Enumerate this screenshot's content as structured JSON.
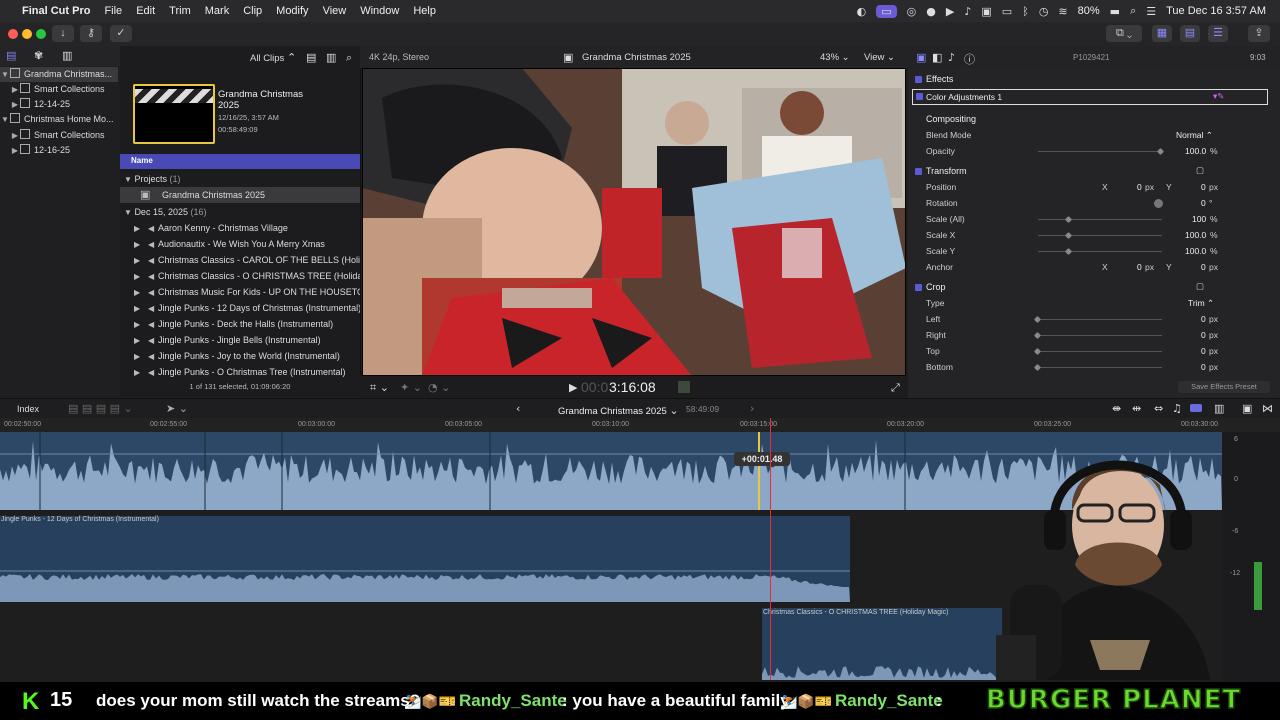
{
  "menubar": {
    "app": "Final Cut Pro",
    "items": [
      "File",
      "Edit",
      "Trim",
      "Mark",
      "Clip",
      "Modify",
      "View",
      "Window",
      "Help"
    ],
    "battery": "80%",
    "datetime": "Tue Dec 16  3:57 AM"
  },
  "library": {
    "items": [
      {
        "label": "Grandma Christmas...",
        "icon": "library-icon"
      },
      {
        "label": "Smart Collections",
        "icon": "folder-icon"
      },
      {
        "label": "12-14-25",
        "icon": "event-icon"
      },
      {
        "label": "Christmas Home Mo...",
        "icon": "library-icon"
      },
      {
        "label": "Smart Collections",
        "icon": "folder-icon"
      },
      {
        "label": "12-16-25",
        "icon": "event-icon"
      }
    ]
  },
  "browser": {
    "filter": "All Clips",
    "project_title": "Grandma Christmas 2025",
    "project_date": "12/16/25, 3:57 AM",
    "project_duration": "00:58:49:09",
    "column_name": "Name",
    "projects_group": "Projects",
    "projects_count": "(1)",
    "project_row": "Grandma Christmas 2025",
    "date_group": "Dec 15, 2025",
    "date_count": "(16)",
    "clips": [
      "Aaron Kenny - Christmas Village",
      "Audionautix - We Wish You A Merry Xmas",
      "Christmas Classics - CAROL OF THE BELLS (Holiday",
      "Christmas Classics - O CHRISTMAS TREE (Holiday",
      "Christmas Music For Kids - UP ON THE HOUSETOP",
      "Jingle Punks - 12 Days of Christmas (Instrumental)",
      "Jingle Punks - Deck the Halls (Instrumental)",
      "Jingle Punks - Jingle Bells (Instrumental)",
      "Jingle Punks - Joy to the World (Instrumental)",
      "Jingle Punks - O Christmas Tree (Instrumental)"
    ],
    "status": "1 of 131 selected, 01:09:06:20"
  },
  "viewer": {
    "format": "4K 24p, Stereo",
    "title": "Grandma Christmas 2025",
    "zoom": "43%",
    "view_label": "View",
    "timecode_dim": "00:0",
    "timecode": "3:16:08"
  },
  "inspector": {
    "clip_id": "P1029421",
    "duration": "9:03",
    "effects_label": "Effects",
    "color_adj": "Color Adjustments 1",
    "compositing": "Compositing",
    "blend_mode": "Blend Mode",
    "blend_value": "Normal",
    "opacity": "Opacity",
    "opacity_value": "100.0",
    "transform": "Transform",
    "position": "Position",
    "pos_x": "0",
    "pos_y": "0",
    "rotation": "Rotation",
    "rotation_value": "0",
    "scale_all": "Scale (All)",
    "scale_all_value": "100",
    "scale_x": "Scale X",
    "scale_x_value": "100.0",
    "scale_y": "Scale Y",
    "scale_y_value": "100.0",
    "anchor": "Anchor",
    "anchor_x": "0",
    "anchor_y": "0",
    "crop": "Crop",
    "type": "Type",
    "type_value": "Trim",
    "left": "Left",
    "right": "Right",
    "top": "Top",
    "bottom": "Bottom",
    "crop_value": "0",
    "px": "px",
    "pct": "%",
    "deg": "°",
    "x": "X",
    "y": "Y",
    "save_preset": "Save Effects Preset"
  },
  "timeline": {
    "index": "Index",
    "title": "Grandma Christmas 2025",
    "duration": "58:49:09",
    "ruler": [
      "00:02:50:00",
      "00:02:55:00",
      "00:03:00:00",
      "00:03:05:00",
      "00:03:10:00",
      "00:03:15:00",
      "00:03:20:00",
      "00:03:25:00",
      "00:03:30:00"
    ],
    "offset": "+00:01.48",
    "music1": "Jingle Punks - 12 Days of Christmas (Instrumental)",
    "music2": "Christmas Classics - O CHRISTMAS TREE (Holiday Magic)",
    "meter": [
      "6",
      "0",
      "-6",
      "-12"
    ]
  },
  "chat": {
    "k": "K",
    "num": "15",
    "msg1": "does your mom still watch the streams?",
    "emotes1": "⛷️📦🎫",
    "user1": "Randy_Sante",
    "msg2": ": you have a beautiful family",
    "emotes2": "⛷️📦🎫",
    "user2": "Randy_Sante",
    "msg3": ":",
    "brand": "BURGER PLANET"
  },
  "colors": {
    "accent": "#5b5bd6",
    "clip_blue": "#2c4866",
    "playhead": "#e0303a",
    "chat_green": "#7ee26a"
  }
}
